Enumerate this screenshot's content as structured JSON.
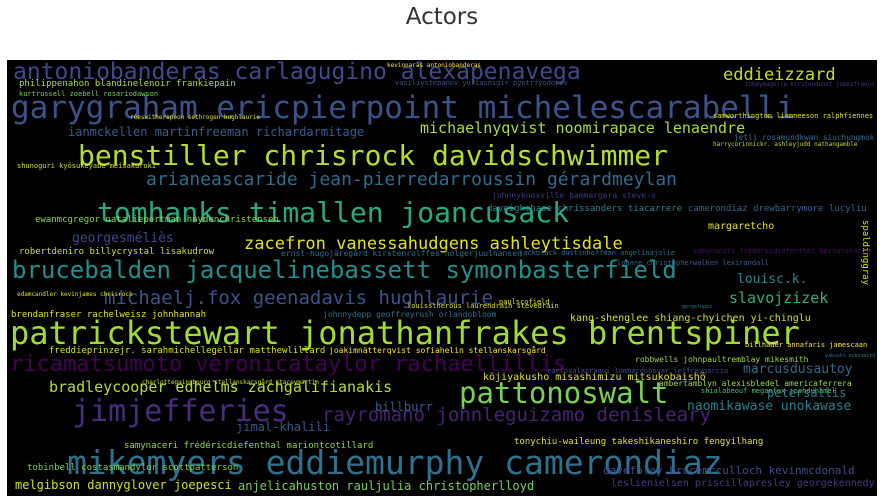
{
  "title": "Actors",
  "words": [
    {
      "text": "antoniobanderas carlagugino alexapenavega",
      "color": "#3f4a8a"
    },
    {
      "text": "eddieizzard",
      "color": "#c2df23"
    },
    {
      "text": "garygraham ericpierpoint michelescarabelli",
      "color": "#3b528b"
    },
    {
      "text": "michaelnyqvist noomirapace lenaendre",
      "color": "#addc30"
    },
    {
      "text": "ianmckellen martinfreeman richardarmitage",
      "color": "#355f8d"
    },
    {
      "text": "benstiller chrisrock davidschwimmer",
      "color": "#b5de2b"
    },
    {
      "text": "arianeascaride jean-pierredarroussin gérardmeylan",
      "color": "#2f6c8e"
    },
    {
      "text": "tomhanks timallen joancusack",
      "color": "#25ab82"
    },
    {
      "text": "georgesméliès",
      "color": "#3e4989"
    },
    {
      "text": "zacefron vanessahudgens ashleytisdale",
      "color": "#e5e419"
    },
    {
      "text": "brucebalden jacquelinebassett symonbasterfield",
      "color": "#218f8d"
    },
    {
      "text": "michaelj.fox geenadavis hughlaurie",
      "color": "#3b528b"
    },
    {
      "text": "louisc.k.",
      "color": "#23898e"
    },
    {
      "text": "slavojzizek",
      "color": "#2db27d"
    },
    {
      "text": "patrickstewart jonathanfrakes brentspiner",
      "color": "#a2da37"
    },
    {
      "text": "ricamatsumoto veronicataylor rachaellillis",
      "color": "#440154"
    },
    {
      "text": "bradleycooper edhelms zachgalifianakis",
      "color": "#b5de2b"
    },
    {
      "text": "pattonoswalt",
      "color": "#7ad151"
    },
    {
      "text": "marcusdusautoy",
      "color": "#31688e"
    },
    {
      "text": "jimjefferies",
      "color": "#472d7b"
    },
    {
      "text": "rayromano johnleguizamo denisleary",
      "color": "#482173"
    },
    {
      "text": "naomikawase unokawase",
      "color": "#26828e"
    },
    {
      "text": "petersallis",
      "color": "#2a788e"
    },
    {
      "text": "billburr",
      "color": "#38588c"
    },
    {
      "text": "jimal-khalili",
      "color": "#39568c"
    },
    {
      "text": "mikemyers eddiemurphy camerondiaz",
      "color": "#2c728e"
    },
    {
      "text": "melgibson dannyglover joepesci",
      "color": "#d0e11c"
    },
    {
      "text": "anjelicahuston rauljulia christopherlloyd",
      "color": "#75d054"
    },
    {
      "text": "leslienielsen priscillapresley georgekennedy",
      "color": "#443983"
    },
    {
      "text": "tobinbell costasmandylor scottpatterson",
      "color": "#7ad151"
    },
    {
      "text": "samynaceri frédéricdiefenthal mariontcotillard",
      "color": "#90d743"
    },
    {
      "text": "davefoley brucemcculloch kevinmcdonald",
      "color": "#3e4c8a"
    },
    {
      "text": "freddieprinzejr. sarahmichellegellar matthewlillard",
      "color": "#d8e219"
    },
    {
      "text": "joakimnätterqvist sofiahelin stellanskarsgård",
      "color": "#fde725"
    },
    {
      "text": "köjiyakusho misashimizu mitsukobaishō",
      "color": "#dde318"
    },
    {
      "text": "kang-shenglee shiang-chyichen yi-chinglu",
      "color": "#d2e21b"
    },
    {
      "text": "brendanfraser rachelweisz johnhannah",
      "color": "#e2e418"
    },
    {
      "text": "johnnydepp geoffreyrush orlandobloom",
      "color": "#2d708e"
    },
    {
      "text": "ewanmcgregor natalieportman haydenchristensen",
      "color": "#86d549"
    },
    {
      "text": "robertdeniro billycrystal lisakudrow",
      "color": "#cae11f"
    },
    {
      "text": "margaretcho",
      "color": "#e7e419"
    },
    {
      "text": "camerondiaz drewbarrymore lucyliu",
      "color": "#33638d"
    },
    {
      "text": "shunoguri kyōsukeyabe meisakuroki",
      "color": "#d0e11c"
    },
    {
      "text": "johnnyknoxville bammargera steve-o",
      "color": "#46337f"
    },
    {
      "text": "daveighchase chrissanders tiacarrere",
      "color": "#25858e"
    },
    {
      "text": "ernst-hugojäregård kirstenrolffes holgerjuulhansen",
      "color": "#2d708e"
    },
    {
      "text": "jackblack dustinhoffman angelinajolie",
      "color": "#2e6e8e"
    },
    {
      "text": "loanne christopherwalken lexirandall",
      "color": "#34618d"
    },
    {
      "text": "billhader annafaris jamescaan",
      "color": "#fde725"
    },
    {
      "text": "yakushi mikesmith",
      "color": "#2b758e"
    },
    {
      "text": "robbwells johnpaultremblay mikesmith",
      "color": "#9dd93b"
    },
    {
      "text": "tonychiu-waileung takeshikaneshiro fengyilhang",
      "color": "#e5e419"
    },
    {
      "text": "philippenahon blandinelenoir frankiepain",
      "color": "#aadc32"
    },
    {
      "text": "kurtrussell zoebell rosariodawson",
      "color": "#77d153"
    },
    {
      "text": "jetli rosamundkwan siuchungmok",
      "color": "#2e6e8e"
    },
    {
      "text": "harrycorinnickr. ashleyjudd nathangamble",
      "color": "#bddf26"
    },
    {
      "text": "samworthington liamneeson ralphfiennes",
      "color": "#dfe318"
    },
    {
      "text": "tobeymaguire kirstendunst jamesfranco",
      "color": "#46327e"
    },
    {
      "text": "spaldinggray",
      "color": "#dde318"
    },
    {
      "text": "ambertamblyn alexisbledel americaferrera",
      "color": "#9bd93c"
    },
    {
      "text": "shialabeouf meganfox joshduhamel",
      "color": "#4ac16d"
    },
    {
      "text": "charlottegainsbourg stellanskarsgård staceymartin",
      "color": "#cde11d"
    },
    {
      "text": "carlosalazraqui lombardoboyar jeffreygarcia",
      "color": "#3e4a89"
    },
    {
      "text": "louisstherous laurendrain stevedrain",
      "color": "#d8e219"
    },
    {
      "text": "paulscofield",
      "color": "#dde318"
    },
    {
      "text": "samynaceri frédéricdiefenthal bernardfarcy",
      "color": "#471063"
    },
    {
      "text": "gorgelopez",
      "color": "#2a788e"
    },
    {
      "text": "edamcandler kevinjames chrisrock",
      "color": "#dde318"
    },
    {
      "text": "reeswitherspoon sethrogen hughlaurie",
      "color": "#dde318"
    },
    {
      "text": "vasiliystepanov yuliasnigir pyotrfyodorov",
      "color": "#3b528b"
    },
    {
      "text": "kevinnaras antoniobanderas",
      "color": "#fde725"
    }
  ]
}
